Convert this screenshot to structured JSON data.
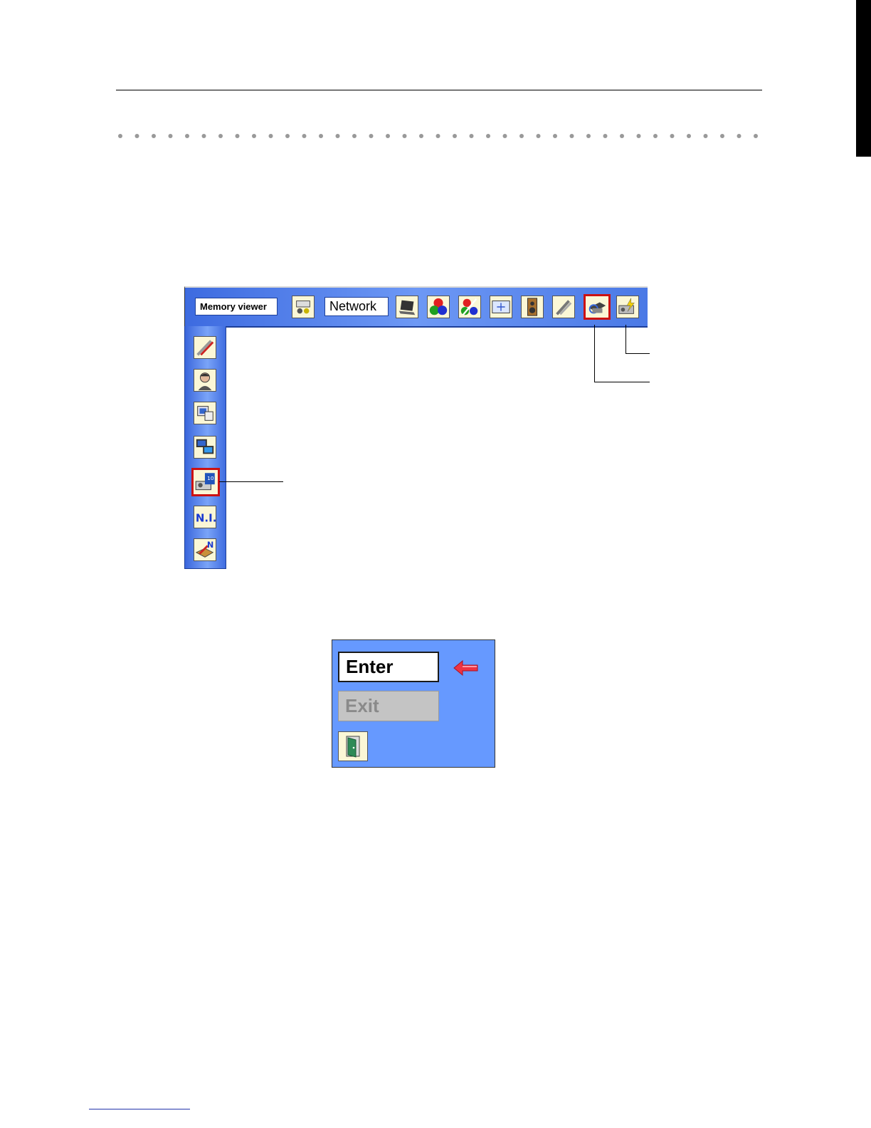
{
  "menu": {
    "memory_viewer_label": "Memory viewer",
    "network_label": "Network",
    "toolbar_icons": [
      "input-icon",
      "network-icon",
      "computer-icon",
      "image-adjust-icon",
      "color-adjust-icon",
      "screen-icon",
      "sound-icon",
      "setting-icon",
      "projector-info-icon",
      "power-management-icon"
    ],
    "side_icons": [
      "network-setting-icon",
      "network-user-icon",
      "network-configuration-icon",
      "network-pc-icon",
      "network-projector-icon",
      "network-information-icon",
      "network-factory-default-icon"
    ],
    "selected_toolbar_icon": "projector-info-icon",
    "selected_side_icon": "network-projector-icon"
  },
  "dialog": {
    "enter_label": "Enter",
    "exit_label": "Exit"
  },
  "colors": {
    "menu_blue": "#6699ff",
    "highlight_red": "#cc1111",
    "arrow_red": "#ee3344"
  }
}
